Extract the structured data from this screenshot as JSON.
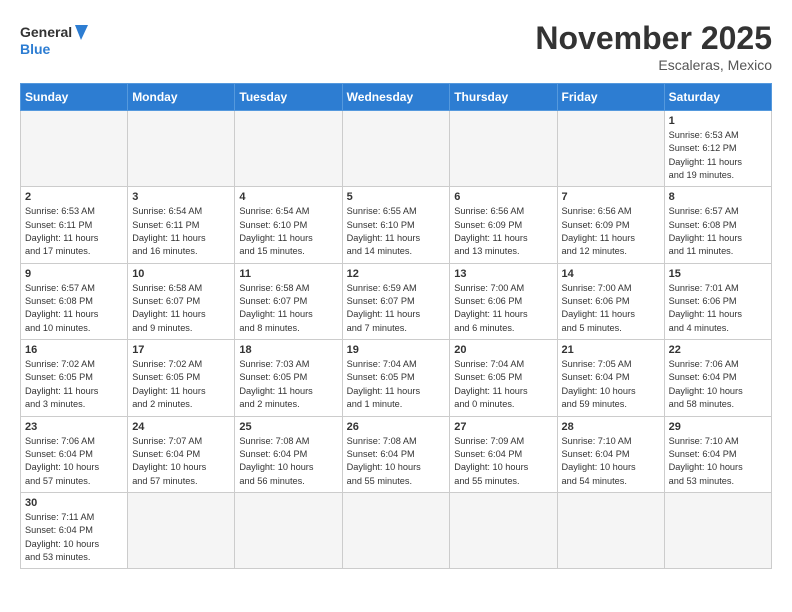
{
  "header": {
    "logo_general": "General",
    "logo_blue": "Blue",
    "month_title": "November 2025",
    "location": "Escaleras, Mexico"
  },
  "weekdays": [
    "Sunday",
    "Monday",
    "Tuesday",
    "Wednesday",
    "Thursday",
    "Friday",
    "Saturday"
  ],
  "weeks": [
    [
      {
        "day": "",
        "info": ""
      },
      {
        "day": "",
        "info": ""
      },
      {
        "day": "",
        "info": ""
      },
      {
        "day": "",
        "info": ""
      },
      {
        "day": "",
        "info": ""
      },
      {
        "day": "",
        "info": ""
      },
      {
        "day": "1",
        "info": "Sunrise: 6:53 AM\nSunset: 6:12 PM\nDaylight: 11 hours\nand 19 minutes."
      }
    ],
    [
      {
        "day": "2",
        "info": "Sunrise: 6:53 AM\nSunset: 6:11 PM\nDaylight: 11 hours\nand 17 minutes."
      },
      {
        "day": "3",
        "info": "Sunrise: 6:54 AM\nSunset: 6:11 PM\nDaylight: 11 hours\nand 16 minutes."
      },
      {
        "day": "4",
        "info": "Sunrise: 6:54 AM\nSunset: 6:10 PM\nDaylight: 11 hours\nand 15 minutes."
      },
      {
        "day": "5",
        "info": "Sunrise: 6:55 AM\nSunset: 6:10 PM\nDaylight: 11 hours\nand 14 minutes."
      },
      {
        "day": "6",
        "info": "Sunrise: 6:56 AM\nSunset: 6:09 PM\nDaylight: 11 hours\nand 13 minutes."
      },
      {
        "day": "7",
        "info": "Sunrise: 6:56 AM\nSunset: 6:09 PM\nDaylight: 11 hours\nand 12 minutes."
      },
      {
        "day": "8",
        "info": "Sunrise: 6:57 AM\nSunset: 6:08 PM\nDaylight: 11 hours\nand 11 minutes."
      }
    ],
    [
      {
        "day": "9",
        "info": "Sunrise: 6:57 AM\nSunset: 6:08 PM\nDaylight: 11 hours\nand 10 minutes."
      },
      {
        "day": "10",
        "info": "Sunrise: 6:58 AM\nSunset: 6:07 PM\nDaylight: 11 hours\nand 9 minutes."
      },
      {
        "day": "11",
        "info": "Sunrise: 6:58 AM\nSunset: 6:07 PM\nDaylight: 11 hours\nand 8 minutes."
      },
      {
        "day": "12",
        "info": "Sunrise: 6:59 AM\nSunset: 6:07 PM\nDaylight: 11 hours\nand 7 minutes."
      },
      {
        "day": "13",
        "info": "Sunrise: 7:00 AM\nSunset: 6:06 PM\nDaylight: 11 hours\nand 6 minutes."
      },
      {
        "day": "14",
        "info": "Sunrise: 7:00 AM\nSunset: 6:06 PM\nDaylight: 11 hours\nand 5 minutes."
      },
      {
        "day": "15",
        "info": "Sunrise: 7:01 AM\nSunset: 6:06 PM\nDaylight: 11 hours\nand 4 minutes."
      }
    ],
    [
      {
        "day": "16",
        "info": "Sunrise: 7:02 AM\nSunset: 6:05 PM\nDaylight: 11 hours\nand 3 minutes."
      },
      {
        "day": "17",
        "info": "Sunrise: 7:02 AM\nSunset: 6:05 PM\nDaylight: 11 hours\nand 2 minutes."
      },
      {
        "day": "18",
        "info": "Sunrise: 7:03 AM\nSunset: 6:05 PM\nDaylight: 11 hours\nand 2 minutes."
      },
      {
        "day": "19",
        "info": "Sunrise: 7:04 AM\nSunset: 6:05 PM\nDaylight: 11 hours\nand 1 minute."
      },
      {
        "day": "20",
        "info": "Sunrise: 7:04 AM\nSunset: 6:05 PM\nDaylight: 11 hours\nand 0 minutes."
      },
      {
        "day": "21",
        "info": "Sunrise: 7:05 AM\nSunset: 6:04 PM\nDaylight: 10 hours\nand 59 minutes."
      },
      {
        "day": "22",
        "info": "Sunrise: 7:06 AM\nSunset: 6:04 PM\nDaylight: 10 hours\nand 58 minutes."
      }
    ],
    [
      {
        "day": "23",
        "info": "Sunrise: 7:06 AM\nSunset: 6:04 PM\nDaylight: 10 hours\nand 57 minutes."
      },
      {
        "day": "24",
        "info": "Sunrise: 7:07 AM\nSunset: 6:04 PM\nDaylight: 10 hours\nand 57 minutes."
      },
      {
        "day": "25",
        "info": "Sunrise: 7:08 AM\nSunset: 6:04 PM\nDaylight: 10 hours\nand 56 minutes."
      },
      {
        "day": "26",
        "info": "Sunrise: 7:08 AM\nSunset: 6:04 PM\nDaylight: 10 hours\nand 55 minutes."
      },
      {
        "day": "27",
        "info": "Sunrise: 7:09 AM\nSunset: 6:04 PM\nDaylight: 10 hours\nand 55 minutes."
      },
      {
        "day": "28",
        "info": "Sunrise: 7:10 AM\nSunset: 6:04 PM\nDaylight: 10 hours\nand 54 minutes."
      },
      {
        "day": "29",
        "info": "Sunrise: 7:10 AM\nSunset: 6:04 PM\nDaylight: 10 hours\nand 53 minutes."
      }
    ],
    [
      {
        "day": "30",
        "info": "Sunrise: 7:11 AM\nSunset: 6:04 PM\nDaylight: 10 hours\nand 53 minutes."
      },
      {
        "day": "",
        "info": ""
      },
      {
        "day": "",
        "info": ""
      },
      {
        "day": "",
        "info": ""
      },
      {
        "day": "",
        "info": ""
      },
      {
        "day": "",
        "info": ""
      },
      {
        "day": "",
        "info": ""
      }
    ]
  ]
}
